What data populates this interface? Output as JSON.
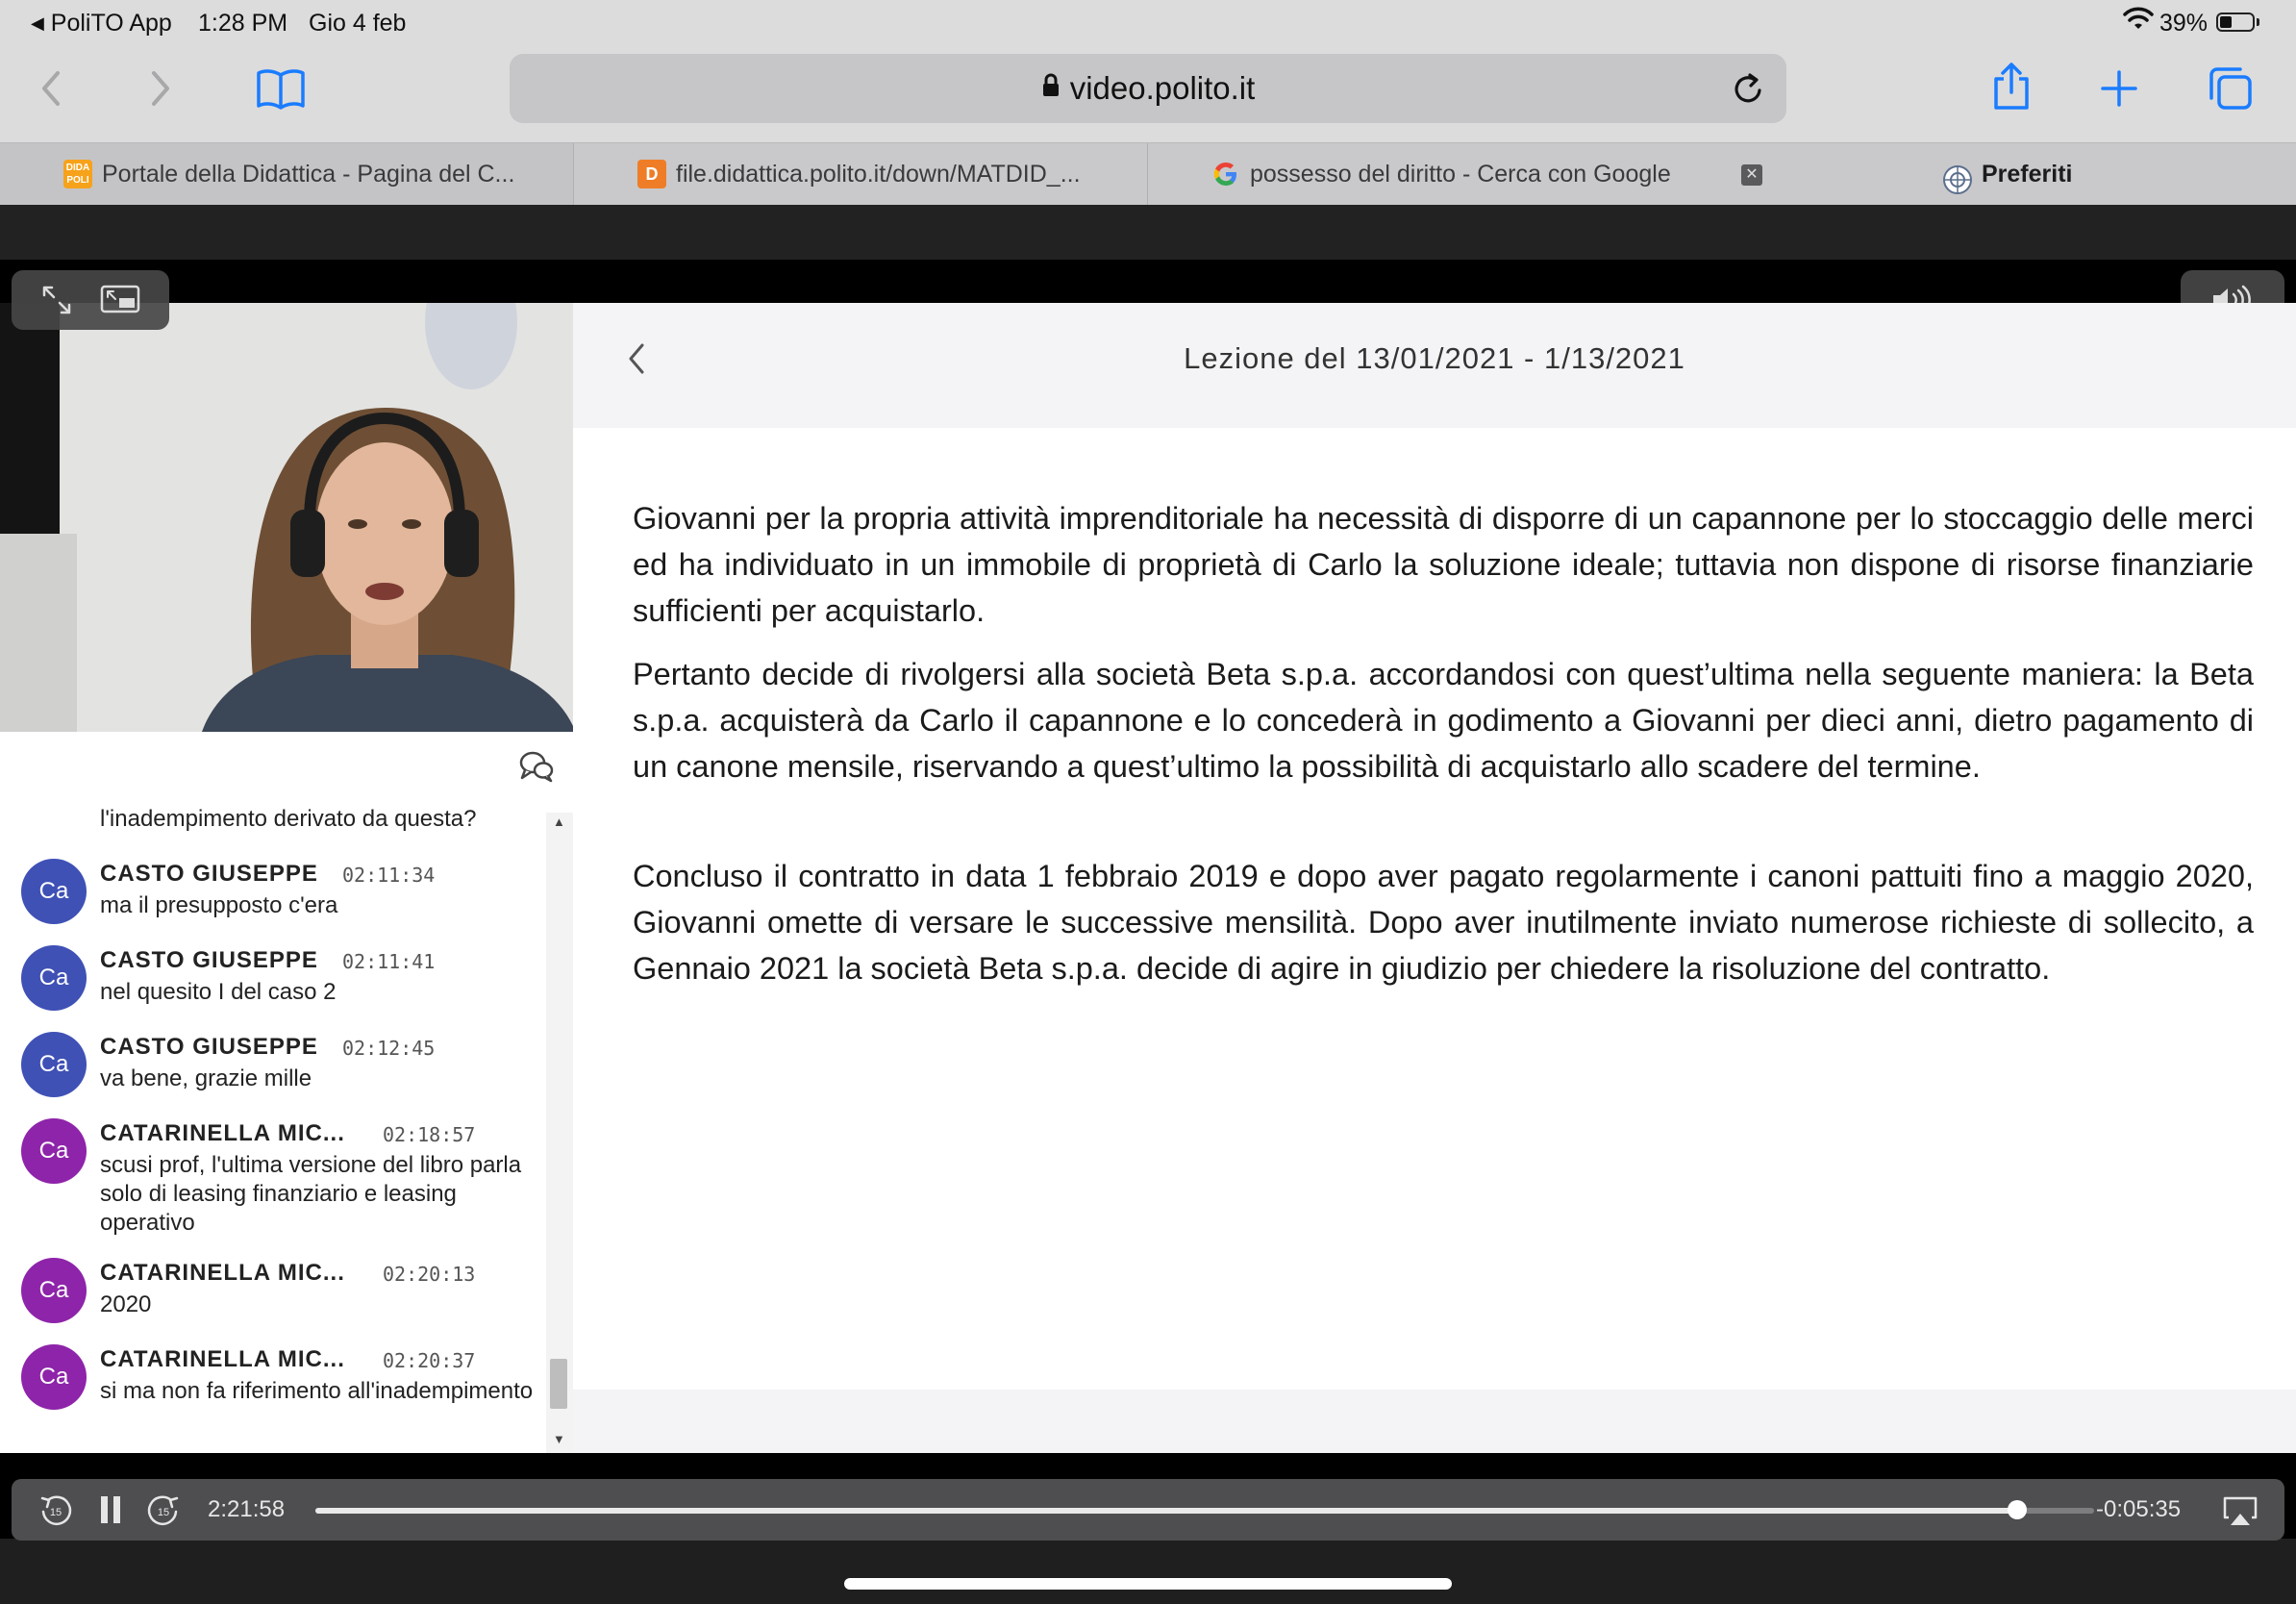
{
  "status_bar": {
    "back_app": "PoliTO App",
    "time": "1:28 PM",
    "date": "Gio 4 feb",
    "battery_percent": "39%",
    "battery_level": 0.39
  },
  "toolbar": {
    "url": "video.polito.it"
  },
  "tabs": [
    {
      "favicon": "DIDA POLI",
      "label": "Portale della Didattica - Pagina del C..."
    },
    {
      "favicon": "D",
      "label": "file.didattica.polito.it/down/MATDID_..."
    },
    {
      "favicon": "G",
      "label": "possesso del diritto - Cerca con Google"
    },
    {
      "favicon": "",
      "label": "Preferiti"
    }
  ],
  "slide": {
    "title": "Lezione del 13/01/2021 - 1/13/2021",
    "paragraphs": [
      "Giovanni per la propria attività imprenditoriale ha necessità di disporre di un capannone per lo stoccaggio delle merci ed ha individuato in un immobile di proprietà di Carlo la soluzione ideale; tuttavia non dispone di risorse finanziarie sufficienti per acquistarlo.",
      "Pertanto decide di rivolgersi alla società Beta s.p.a. accordandosi con quest’ultima nella seguente maniera: la Beta s.p.a. acquisterà da Carlo il capannone e lo concederà in godimento a Giovanni per dieci anni, dietro pagamento di un canone mensile, riservando a quest’ultimo la possibilità di acquistarlo allo scadere del termine.",
      "Concluso il contratto in data 1 febbraio 2019 e dopo aver pagato regolarmente i canoni pattuiti fino a maggio 2020, Giovanni omette di versare le successive mensilità. Dopo aver inutilmente inviato numerose richieste di sollecito, a Gennaio 2021 la società Beta s.p.a. decide di agire in giudizio per chiedere la risoluzione del contratto."
    ]
  },
  "chat": {
    "partial_message": "l'inadempimento derivato da questa?",
    "messages": [
      {
        "initials": "Ca",
        "author": "CASTO GIUSEPPE",
        "time": "02:11:34",
        "text": "ma il presupposto c'era",
        "color": "#3f51b5"
      },
      {
        "initials": "Ca",
        "author": "CASTO GIUSEPPE",
        "time": "02:11:41",
        "text": "nel quesito I del caso 2",
        "color": "#3f51b5"
      },
      {
        "initials": "Ca",
        "author": "CASTO GIUSEPPE",
        "time": "02:12:45",
        "text": "va bene, grazie mille",
        "color": "#3f51b5"
      },
      {
        "initials": "Ca",
        "author": "CATARINELLA MIC...",
        "time": "02:18:57",
        "text": "scusi prof, l'ultima versione del libro parla solo di leasing finanziario e leasing operativo",
        "color": "#8e24aa"
      },
      {
        "initials": "Ca",
        "author": "CATARINELLA MIC...",
        "time": "02:20:13",
        "text": "2020",
        "color": "#8e24aa"
      },
      {
        "initials": "Ca",
        "author": "CATARINELLA MIC...",
        "time": "02:20:37",
        "text": "si ma non fa riferimento all'inadempimento",
        "color": "#8e24aa"
      }
    ]
  },
  "player": {
    "elapsed": "2:21:58",
    "remaining": "-0:05:35",
    "progress": 0.957,
    "skip_seconds": "15"
  },
  "colors": {
    "accent": "#1a7cff",
    "toolbar_bg": "#dcdcdc",
    "tab_bg": "#c9c9cb"
  }
}
